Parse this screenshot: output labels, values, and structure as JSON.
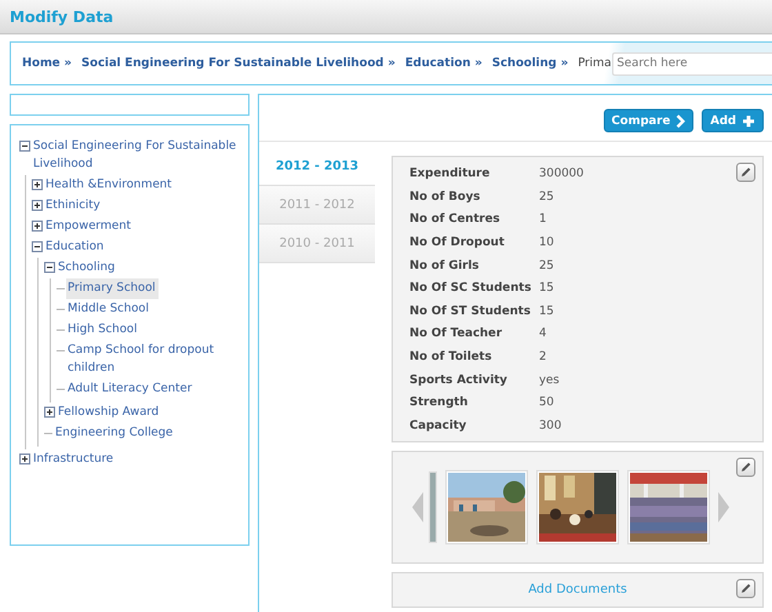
{
  "window": {
    "title": "Modify Data"
  },
  "breadcrumb": {
    "links": [
      "Home »",
      "Social Engineering For Sustainable Livelihood »",
      "Education »",
      "Schooling »"
    ],
    "current": "Prima"
  },
  "search": {
    "placeholder": "Search here"
  },
  "tree": [
    {
      "label": "Social Engineering For Sustainable Livelihood",
      "kind": "folder",
      "expanded": true,
      "selected": false,
      "children": [
        {
          "label": "Health &Environment",
          "kind": "folder",
          "expanded": false,
          "selected": false
        },
        {
          "label": "Ethinicity",
          "kind": "folder",
          "expanded": false,
          "selected": false
        },
        {
          "label": "Empowerment",
          "kind": "folder",
          "expanded": false,
          "selected": false
        },
        {
          "label": "Education",
          "kind": "folder",
          "expanded": true,
          "selected": false,
          "children": [
            {
              "label": "Schooling",
              "kind": "folder",
              "expanded": true,
              "selected": false,
              "children": [
                {
                  "label": "Primary School",
                  "kind": "leaf",
                  "selected": true
                },
                {
                  "label": "Middle School",
                  "kind": "leaf",
                  "selected": false
                },
                {
                  "label": "High School",
                  "kind": "leaf",
                  "selected": false
                },
                {
                  "label": "Camp School for dropout children",
                  "kind": "leaf",
                  "selected": false
                },
                {
                  "label": "Adult Literacy Center",
                  "kind": "leaf",
                  "selected": false
                }
              ]
            },
            {
              "label": "Fellowship Award",
              "kind": "folder",
              "expanded": false,
              "selected": false
            },
            {
              "label": "Engineering College",
              "kind": "leaf",
              "selected": false
            }
          ]
        }
      ]
    },
    {
      "label": "Infrastructure",
      "kind": "folder",
      "expanded": false,
      "selected": false
    }
  ],
  "buttons": [
    {
      "label": "Compare",
      "kind": "next"
    },
    {
      "label": "Add",
      "kind": "add"
    }
  ],
  "years": [
    {
      "label": "2012 - 2013",
      "selected": true
    },
    {
      "label": "2011 - 2012",
      "selected": false
    },
    {
      "label": "2010 - 2011",
      "selected": false
    }
  ],
  "fields": [
    {
      "label": "Expenditure",
      "value": "300000"
    },
    {
      "label": "No of Boys",
      "value": "25"
    },
    {
      "label": "No of Centres",
      "value": "1"
    },
    {
      "label": "No Of Dropout",
      "value": "10"
    },
    {
      "label": "No of Girls",
      "value": "25"
    },
    {
      "label": "No Of SC Students",
      "value": "15"
    },
    {
      "label": "No Of ST Students",
      "value": "15"
    },
    {
      "label": "No Of Teacher",
      "value": "4"
    },
    {
      "label": "No of Toilets",
      "value": "2"
    },
    {
      "label": "Sports Activity",
      "value": "yes"
    },
    {
      "label": "Strength",
      "value": "50"
    },
    {
      "label": "Capacity",
      "value": "300"
    }
  ],
  "documents": {
    "link": "Add Documents"
  }
}
